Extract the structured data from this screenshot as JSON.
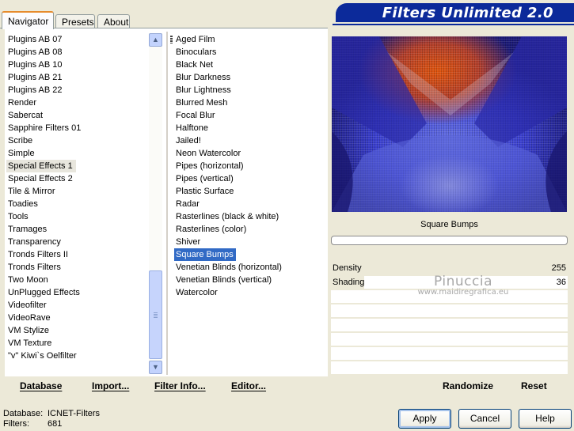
{
  "tabs": [
    "Navigator",
    "Presets",
    "About"
  ],
  "banner": "Filters Unlimited 2.0",
  "categories": [
    "Plugins AB 07",
    "Plugins AB 08",
    "Plugins AB 10",
    "Plugins AB 21",
    "Plugins AB 22",
    "Render",
    "Sabercat",
    "Sapphire Filters 01",
    "Scribe",
    "Simple",
    "Special Effects 1",
    "Special Effects 2",
    "Tile & Mirror",
    "Toadies",
    "Tools",
    "Tramages",
    "Transparency",
    "Tronds Filters II",
    "Tronds Filters",
    "Two Moon",
    "UnPlugged Effects",
    "Videofilter",
    "VideoRave",
    "VM Stylize",
    "VM Texture",
    "\"v\" Kiwi`s Oelfilter"
  ],
  "selected_category": "Special Effects 1",
  "filters": [
    "Aged Film",
    "Binoculars",
    "Black Net",
    "Blur Darkness",
    "Blur Lightness",
    "Blurred Mesh",
    "Focal Blur",
    "Halftone",
    "Jailed!",
    "Neon Watercolor",
    "Pipes (horizontal)",
    "Pipes (vertical)",
    "Plastic Surface",
    "Radar",
    "Rasterlines (black & white)",
    "Rasterlines (color)",
    "Shiver",
    "Square Bumps",
    "Venetian Blinds (horizontal)",
    "Venetian Blinds (vertical)",
    "Watercolor"
  ],
  "selected_filter": "Square Bumps",
  "left_toolbar": {
    "database": "Database",
    "import": "Import...",
    "filter_info": "Filter Info...",
    "editor": "Editor..."
  },
  "preview_filter_name": "Square Bumps",
  "params": [
    {
      "label": "Density",
      "value": "255",
      "fraction": 1.0
    },
    {
      "label": "Shading",
      "value": "36",
      "fraction": 0.14
    }
  ],
  "watermark": {
    "line1": "Pinuccia",
    "line2": "www.maidiregrafica.eu"
  },
  "right_toolbar": {
    "randomize": "Randomize",
    "reset": "Reset"
  },
  "status": {
    "database_label": "Database:",
    "database_value": "ICNET-Filters",
    "filters_label": "Filters:",
    "filters_value": "681"
  },
  "dialog_buttons": {
    "apply": "Apply",
    "cancel": "Cancel",
    "help": "Help"
  },
  "colors": {
    "selection": "#316ac5",
    "banner": "#0c2a9a",
    "window": "#ece9d8"
  }
}
